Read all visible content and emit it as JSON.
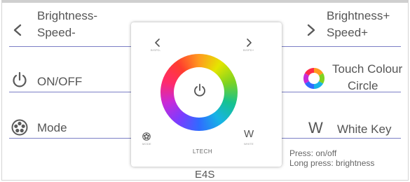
{
  "labels": {
    "brightness_minus": "Brightness-",
    "speed_minus": "Speed-",
    "brightness_plus": "Brightness+",
    "speed_plus": "Speed+",
    "on_off": "ON/OFF",
    "touch_colour": "Touch Colour",
    "circle": "Circle",
    "mode": "Mode",
    "white_key_letter": "W",
    "white_key": "White Key",
    "press_on_off": "Press: on/off",
    "long_press": "Long press: brightness"
  },
  "panel": {
    "brand": "LTECH",
    "model": "E4S",
    "speed_minus_tiny": "B/SPD-",
    "speed_plus_tiny": "B/SPD+",
    "mode_tiny": "MODE",
    "white_tiny": "WHITE",
    "w_letter": "W"
  },
  "icons": {
    "left": "chevron-left-icon",
    "right": "chevron-right-icon",
    "power": "power-icon",
    "color_wheel": "color-wheel-icon",
    "mode": "mode-icon"
  },
  "colors": {
    "line": "#7b7fc6",
    "text": "#555555",
    "icon": "#5a5a5a"
  }
}
